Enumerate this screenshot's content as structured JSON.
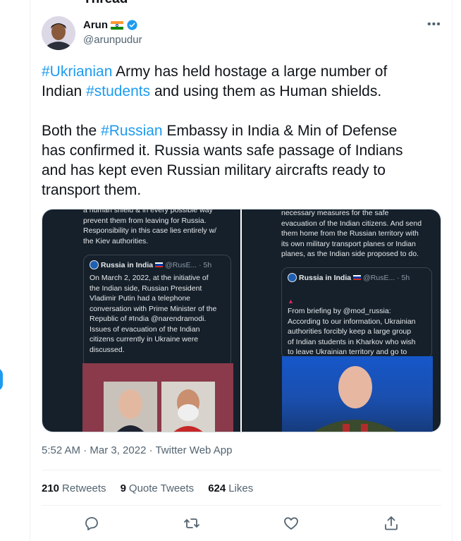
{
  "header": {
    "title": "Thread"
  },
  "author": {
    "name": "Arun",
    "handle": "@arunpudur",
    "flag": "india-flag",
    "verified": "verified-badge-icon"
  },
  "tweet": {
    "line1": [
      {
        "text": "#Ukrianian",
        "hashtag": true
      },
      {
        "text": " Army has held hostage a large number of\nIndian ",
        "hashtag": false
      },
      {
        "text": "#students",
        "hashtag": true
      },
      {
        "text": " and using them as Human shields.\n\nBoth the ",
        "hashtag": false
      },
      {
        "text": "#Russian",
        "hashtag": true
      },
      {
        "text": " Embassy in India & Min of Defense\nhas confirmed it. Russia wants safe passage of Indians\nand has kept even Russian military aircrafts ready to\ntransport them.",
        "hashtag": false
      }
    ]
  },
  "media": {
    "left": {
      "top_text": "a human shield & in every possible way\nprevent them from leaving for Russia.\nResponsibility in this case lies entirely w/\nthe Kiev authorities.",
      "quote_name": "Russia in India",
      "quote_meta": "@RusE... · 5h",
      "quote_body": "On March 2, 2022, at the initiative of\nthe Indian side, Russian President\nVladimir Putin had a telephone\nconversation with Prime Minister of the\nRepublic of #India @narendramodi.\nIssues of evacuation of the  Indian\ncitizens currently in Ukraine were\ndiscussed."
    },
    "right": {
      "top_text": "necessary measures for the safe\nevacuation of the Indian citizens. And send\nthem home from the Russian territory with\nits own military transport planes or Indian\nplanes, as the Indian side proposed to do.",
      "quote_name": "Russia in India",
      "quote_meta": "@RusE... · 5h",
      "quote_body": "From briefing by @mod_russia:\nAccording to our information, Ukrainian\nauthorities forcibly keep a large group\nof Indian students in Kharkov who wish\nto leave Ukrainian territory and go to\nBelgorod."
    }
  },
  "timestamp": "5:52 AM · Mar 3, 2022 · Twitter Web App",
  "stats": {
    "retweets_count": "210",
    "retweets_label": "Retweets",
    "quotes_count": "9",
    "quotes_label": "Quote Tweets",
    "likes_count": "624",
    "likes_label": "Likes"
  },
  "actions": [
    "reply-icon",
    "retweet-icon",
    "like-icon",
    "share-icon"
  ],
  "colors": {
    "accent": "#1d9bf0",
    "text": "#0f1419",
    "muted": "#536471",
    "border": "#eff3f4"
  }
}
